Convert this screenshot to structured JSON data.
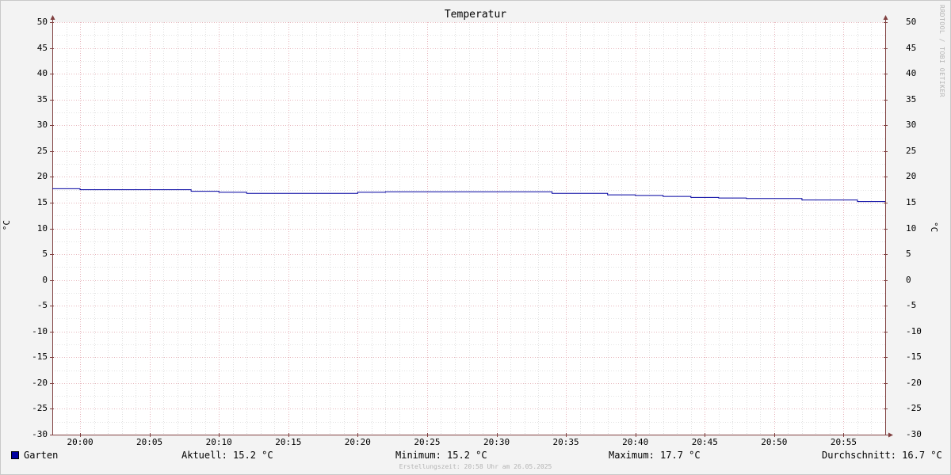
{
  "chart_data": {
    "type": "line",
    "title": "Temperatur",
    "ylabel": "°C",
    "ylim": [
      -30,
      50
    ],
    "yticks": [
      50,
      45,
      40,
      35,
      30,
      25,
      20,
      15,
      10,
      5,
      0,
      -5,
      -10,
      -15,
      -20,
      -25,
      -30
    ],
    "xlim": [
      "19:58",
      "20:58"
    ],
    "xticks": [
      "20:00",
      "20:05",
      "20:10",
      "20:15",
      "20:20",
      "20:25",
      "20:30",
      "20:35",
      "20:40",
      "20:45",
      "20:50",
      "20:55"
    ],
    "grid": true,
    "series": [
      {
        "name": "Garten",
        "color": "#0000a0",
        "step": true,
        "points": [
          [
            "19:58",
            17.7
          ],
          [
            "20:00",
            17.5
          ],
          [
            "20:08",
            17.2
          ],
          [
            "20:10",
            17.0
          ],
          [
            "20:12",
            16.8
          ],
          [
            "20:20",
            17.0
          ],
          [
            "20:22",
            17.1
          ],
          [
            "20:34",
            16.8
          ],
          [
            "20:38",
            16.5
          ],
          [
            "20:40",
            16.4
          ],
          [
            "20:42",
            16.2
          ],
          [
            "20:44",
            16.0
          ],
          [
            "20:46",
            15.9
          ],
          [
            "20:48",
            15.8
          ],
          [
            "20:52",
            15.5
          ],
          [
            "20:56",
            15.2
          ],
          [
            "20:58",
            15.2
          ]
        ]
      }
    ]
  },
  "legend": {
    "series_name": "Garten",
    "current": "Aktuell: 15.2 °C",
    "minimum": "Minimum: 15.2 °C",
    "maximum": "Maximum: 17.7 °C",
    "average": "Durchschnitt: 16.7 °C"
  },
  "watermark": "RRDTOOL / TOBI OETIKER",
  "footer": "Erstellungszeit: 20:58 Uhr am 26.05.2025",
  "colors": {
    "canvas": "#ffffff",
    "background": "#f3f3f3",
    "major_grid": "#e0a0a8",
    "minor_grid": "#c8c8c8",
    "axis": "#804040",
    "series": "#0000a0"
  }
}
